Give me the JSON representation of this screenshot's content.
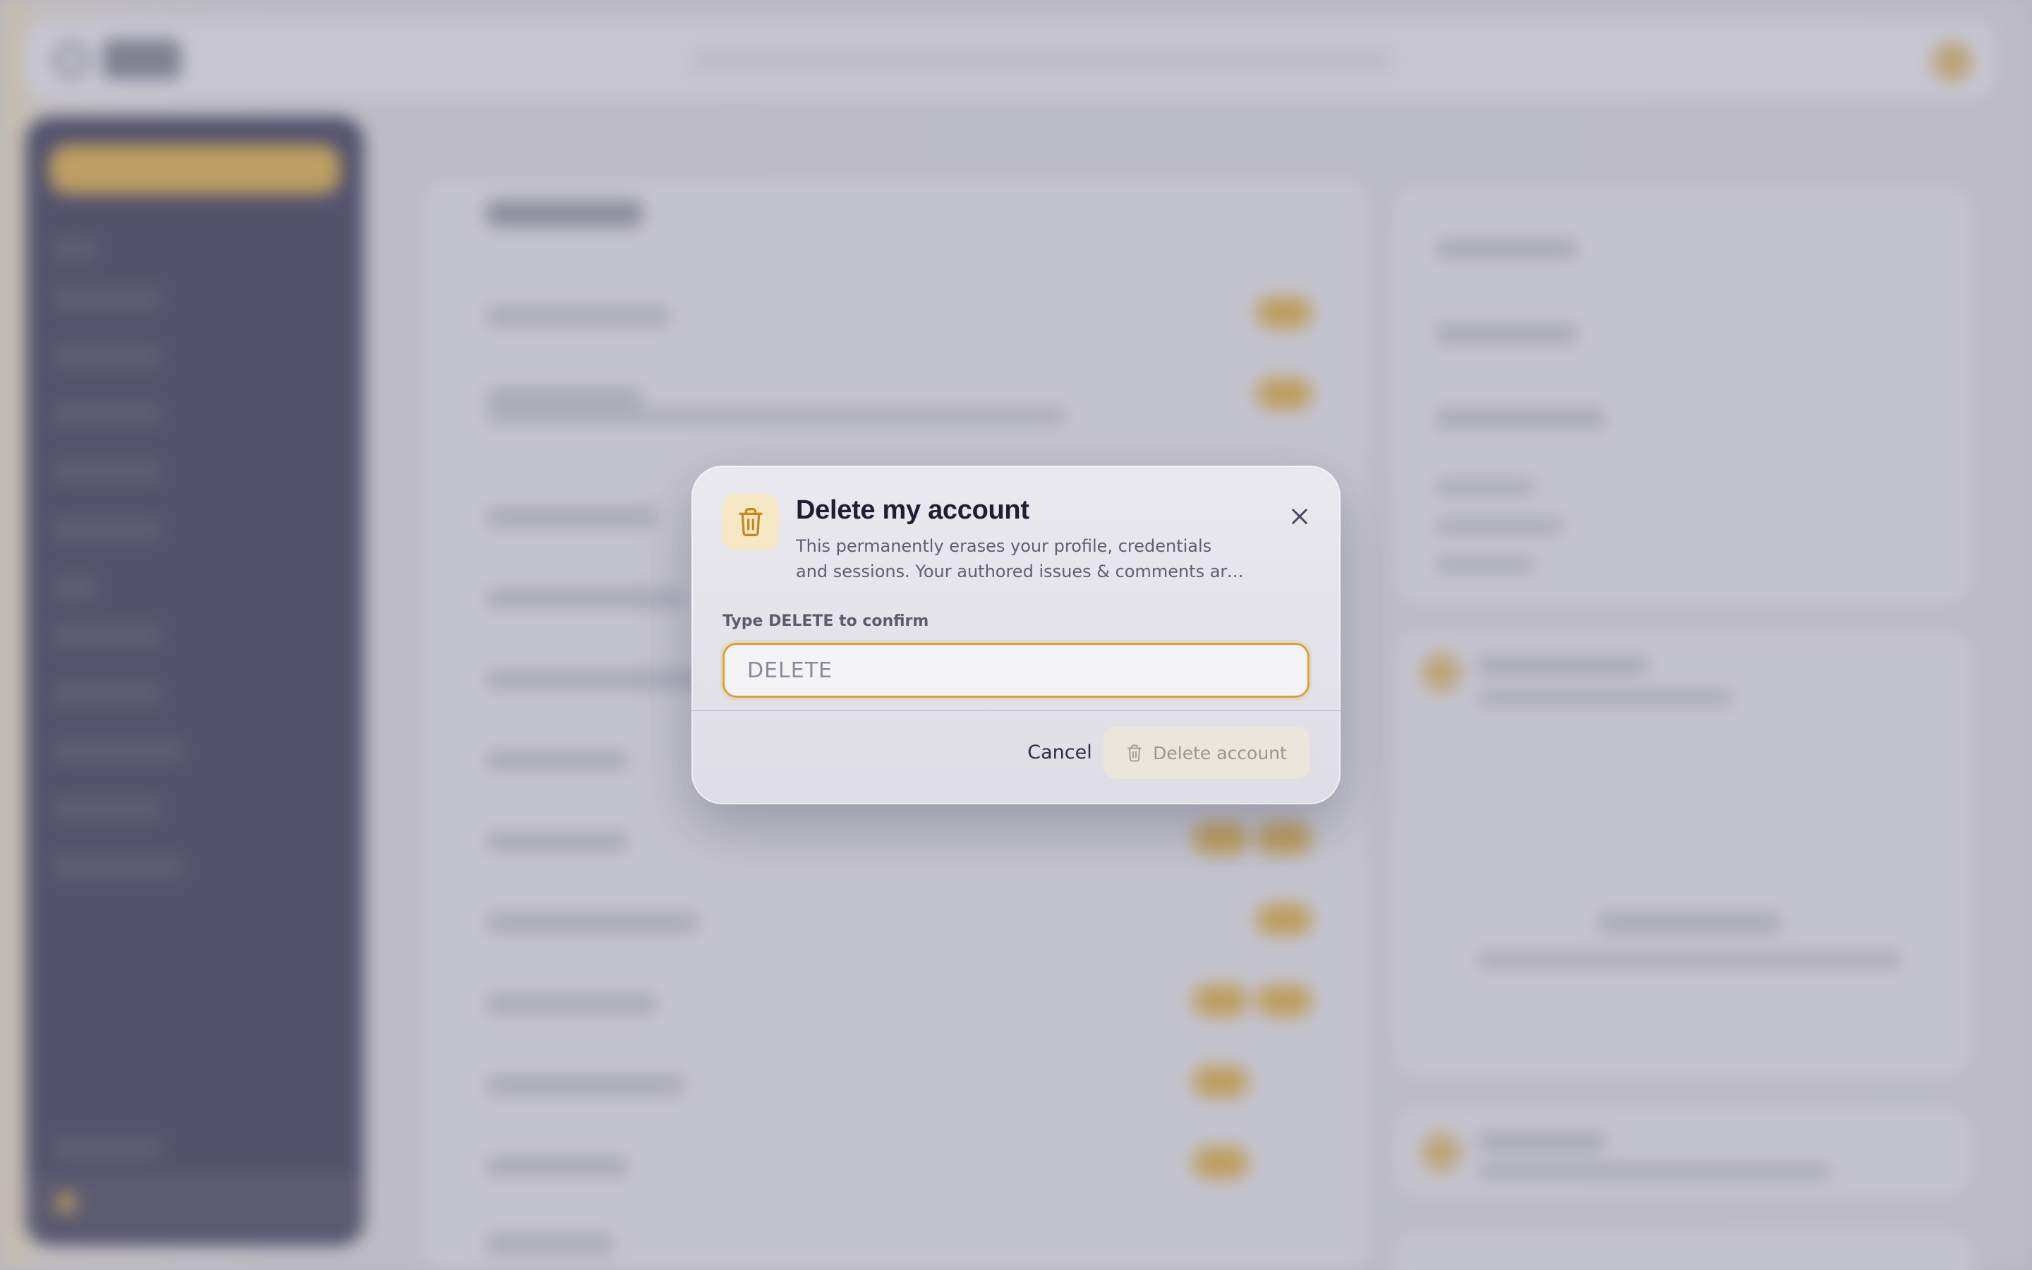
{
  "modal": {
    "title": "Delete my account",
    "description": "This permanently erases your profile, credentials and sessions. Your authored issues & comments are anonymized.",
    "field_label": "Type DELETE to confirm",
    "input_placeholder": "DELETE",
    "input_value": "",
    "cancel_label": "Cancel",
    "delete_label": "Delete account",
    "icons": {
      "header": "trash-icon",
      "close": "close-icon",
      "delete_button": "trash-icon"
    },
    "colors": {
      "accent": "#d9a33a",
      "icon_bg": "#f6e8c4",
      "title": "#1f1e34",
      "disabled_button_bg": "#ebe6dc"
    }
  }
}
